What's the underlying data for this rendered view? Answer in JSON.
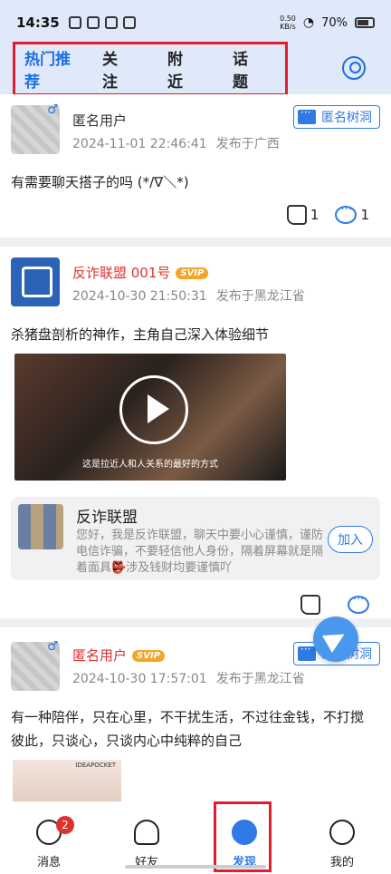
{
  "status": {
    "time": "14:35",
    "net_speed_value": "0.50",
    "net_speed_unit": "KB/s",
    "battery": "70%"
  },
  "header": {
    "tabs": [
      {
        "label": "热门推荐",
        "active": true
      },
      {
        "label": "关注"
      },
      {
        "label": "附近"
      },
      {
        "label": "话题"
      }
    ]
  },
  "posts": [
    {
      "user": "匿名用户",
      "time": "2024-11-01 22:46:41",
      "location": "发布于广西",
      "tag": "匿名树洞",
      "text": "有需要聊天搭子的吗 (*/∇＼*)",
      "likes": "1",
      "comments": "1"
    },
    {
      "user": "反诈联盟 001号",
      "vip": "SVIP",
      "time": "2024-10-30 21:50:31",
      "location": "发布于黑龙江省",
      "text": "杀猪盘剖析的神作，主角自己深入体验细节",
      "video_subtitle": "这是拉近人和人关系的最好的方式",
      "group": {
        "name": "反诈联盟",
        "desc": "您好，我是反诈联盟，聊天中要小心谨慎，谨防电信诈骗，不要轻信他人身份，隔着屏幕就是隔着面具👺涉及钱财均要谨慎吖",
        "join": "加入"
      }
    },
    {
      "user": "匿名用户",
      "vip": "SVIP",
      "time": "2024-10-30 17:57:01",
      "location": "发布于黑龙江省",
      "tag": "匿名树洞",
      "text_line1": "有一种陪伴，只在心里，不干扰生活，不过往金钱，不打搅",
      "text_line2": "彼此，只谈心，只谈内心中纯粹的自己",
      "photo_brand": "IDEAPOCKET"
    }
  ],
  "nav": {
    "items": [
      {
        "label": "消息",
        "badge": "2"
      },
      {
        "label": "好友"
      },
      {
        "label": "发现",
        "active": true
      },
      {
        "label": "我的"
      }
    ]
  },
  "colors": {
    "accent": "#2f7ae5",
    "highlight": "#e01e2e",
    "vip_red": "#e0312d"
  }
}
